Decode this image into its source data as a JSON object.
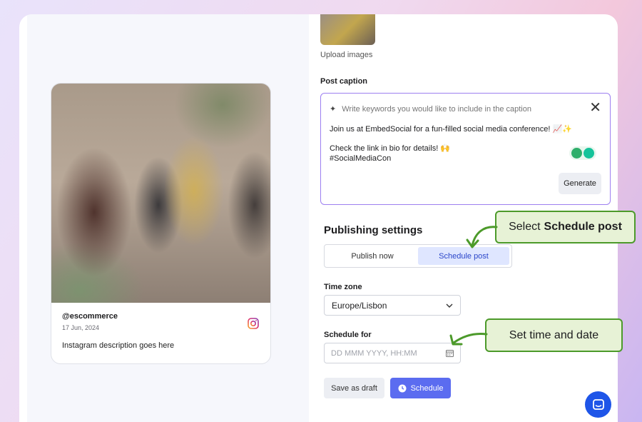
{
  "preview": {
    "handle": "@escommerce",
    "date": "17 Jun, 2024",
    "description": "Instagram description goes here"
  },
  "upload": {
    "label": "Upload images"
  },
  "caption": {
    "title": "Post caption",
    "keywords_placeholder": "Write keywords you would like to include in the caption",
    "line1": "Join us at EmbedSocial for a fun-filled social media conference! 📈✨",
    "line2": "Check the link in bio for details! 🙌",
    "line3": "#SocialMediaCon",
    "generate_label": "Generate"
  },
  "publishing": {
    "title": "Publishing settings",
    "tabs": [
      {
        "label": "Publish now",
        "active": false
      },
      {
        "label": "Schedule post",
        "active": true
      }
    ],
    "timezone_label": "Time zone",
    "timezone_value": "Europe/Lisbon",
    "schedule_for_label": "Schedule for",
    "schedule_placeholder": "DD MMM YYYY, HH:MM",
    "draft_label": "Save as draft",
    "schedule_label": "Schedule"
  },
  "callouts": {
    "first_prefix": "Select",
    "first_bold": "Schedule post",
    "second": "Set time and date"
  },
  "colors": {
    "accent": "#5b6cf0",
    "active_tab_bg": "#dfe6ff",
    "callout_border": "#4c9a2a",
    "callout_bg": "#e7f2d6",
    "caption_border": "#9d7ff0",
    "chat_bubble": "#1e55e8"
  },
  "icons": [
    "instagram-icon",
    "sparkle-icon",
    "close-icon",
    "grammarly-icon",
    "chevron-down-icon",
    "calendar-icon",
    "clock-icon",
    "chat-icon",
    "arrow-icon"
  ]
}
